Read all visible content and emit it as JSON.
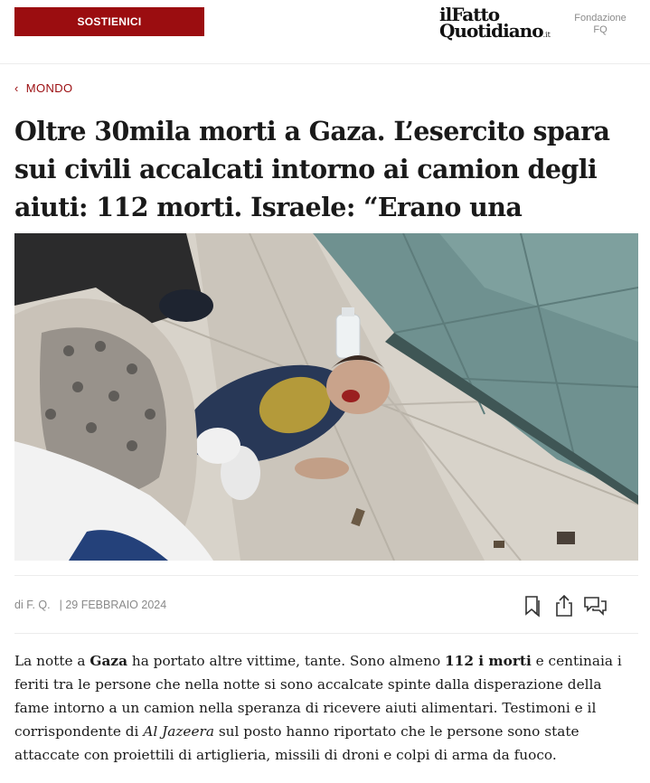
{
  "header": {
    "support_label": "SOSTIENICI",
    "logo_line1": "ilFatto",
    "logo_line2": "Quotidiano",
    "logo_suffix": ".it",
    "fondazione_line1": "Fondazione",
    "fondazione_line2": "FQ"
  },
  "article": {
    "section": "MONDO",
    "headline": "Oltre 30mila morti a Gaza. L’esercito spara sui civili accalcati intorno ai camion degli aiuti: 112 morti. Israele: “Erano una minaccia”",
    "author": "di F. Q.",
    "date": "| 29 FEBBRAIO 2024",
    "body": {
      "p1": "La notte a ",
      "b1": "Gaza",
      "p2": " ha portato altre vittime, tante. Sono almeno ",
      "b2": "112 i morti",
      "p3": " e centinaia i feriti tra le persone che nella notte si sono accalcate spinte dalla disperazione della fame intorno a un camion nella speranza di ricevere aiuti alimentari. Testimoni e il corrispondente di ",
      "i1": "Al Jazeera",
      "p4": " sul posto hanno riportato che le persone sono state attaccate con proiettili di artiglieria, missili di droni e colpi di arma da fuoco."
    }
  },
  "actions": [
    "bookmark-icon",
    "share-icon",
    "comments-icon"
  ],
  "colors": {
    "accent": "#9b0d10",
    "muted": "#8a8a8a",
    "divider": "#ececec"
  }
}
